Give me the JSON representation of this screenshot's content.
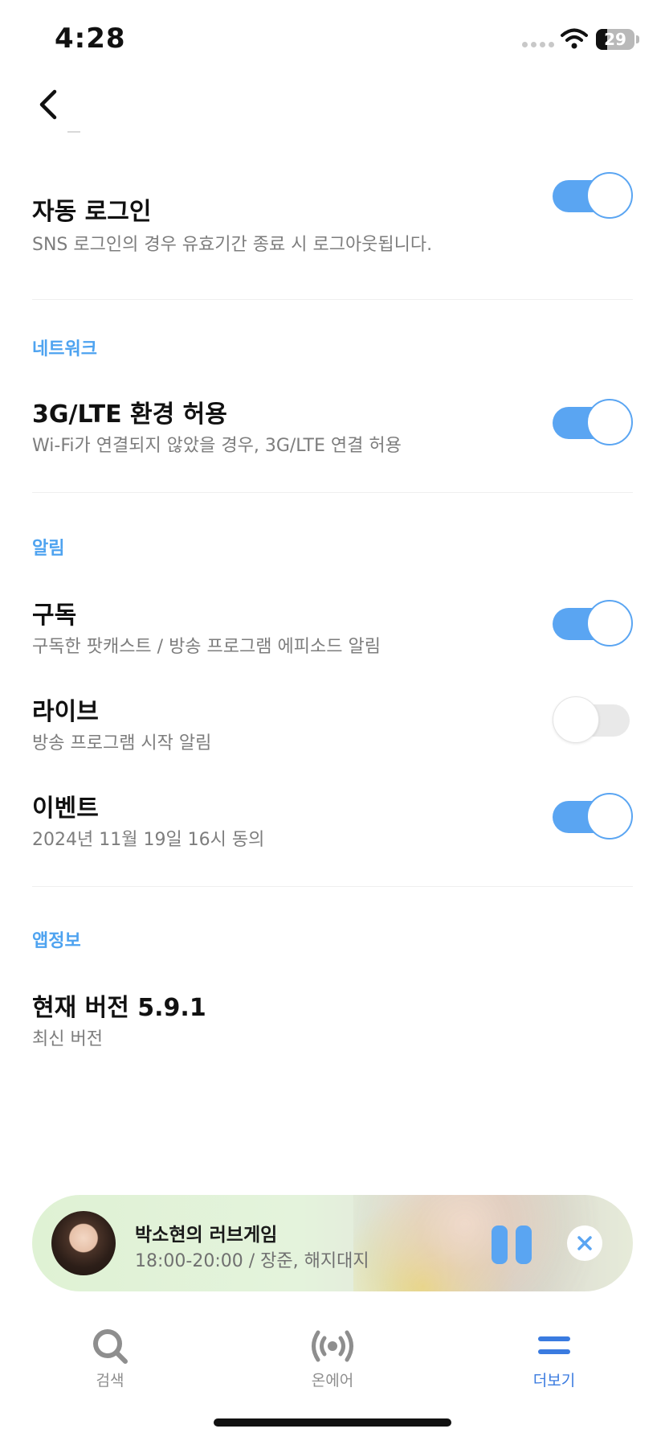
{
  "status_bar": {
    "time": "4:28",
    "battery_level": "29",
    "battery_fraction": 0.29
  },
  "header": {
    "back_icon": "chevron-left-icon"
  },
  "settings": {
    "auto_login": {
      "title": "자동 로그인",
      "description": "SNS 로그인의 경우 유효기간 종료 시 로그아웃됩니다.",
      "enabled": true
    },
    "network": {
      "section_label": "네트워크",
      "cellular": {
        "title": "3G/LTE 환경 허용",
        "description": "Wi-Fi가 연결되지 않았을 경우, 3G/LTE 연결 허용",
        "enabled": true
      }
    },
    "notifications": {
      "section_label": "알림",
      "subscribe": {
        "title": "구독",
        "description": "구독한 팟캐스트 / 방송 프로그램 에피소드 알림",
        "enabled": true
      },
      "live": {
        "title": "라이브",
        "description": "방송 프로그램 시작 알림",
        "enabled": false
      },
      "event": {
        "title": "이벤트",
        "description": "2024년 11월 19일 16시 동의",
        "enabled": true
      }
    },
    "app_info": {
      "section_label": "앱정보",
      "version_title": "현재 버전 5.9.1",
      "version_status": "최신 버전"
    }
  },
  "mini_player": {
    "title": "박소현의 러브게임",
    "subtitle": "18:00-20:00 / 장준, 해지대지",
    "pause_icon": "pause-icon",
    "close_icon": "close-icon"
  },
  "tab_bar": {
    "items": [
      {
        "label": "검색",
        "icon": "search-icon",
        "active": false
      },
      {
        "label": "온에어",
        "icon": "broadcast-icon",
        "active": false
      },
      {
        "label": "더보기",
        "icon": "menu-icon",
        "active": true
      }
    ]
  },
  "colors": {
    "accent": "#5aa5f2",
    "section_label": "#4ea3f0",
    "active_tab": "#3a7be0"
  }
}
